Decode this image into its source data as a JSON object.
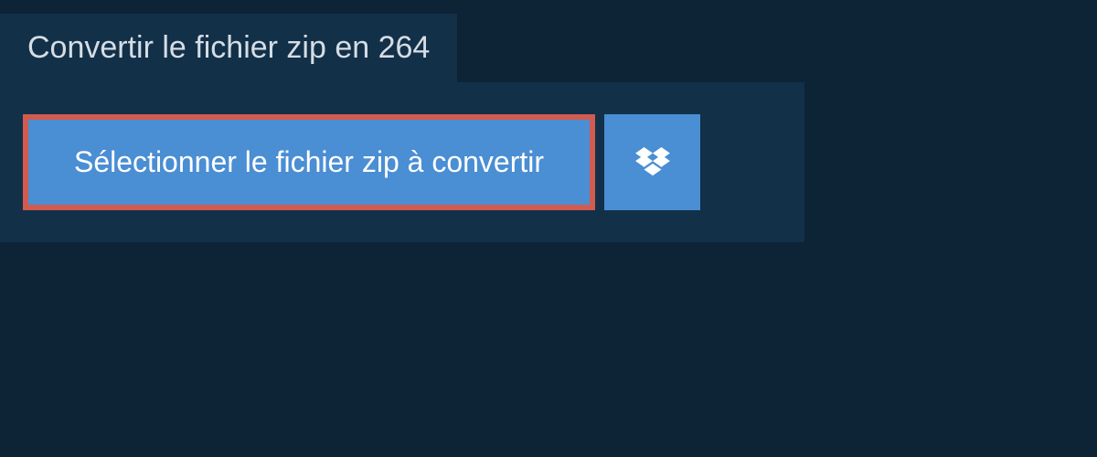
{
  "tab": {
    "title": "Convertir le fichier zip en 264"
  },
  "buttons": {
    "select_file": "Sélectionner le fichier zip à convertir"
  },
  "colors": {
    "background": "#0d2336",
    "panel": "#133049",
    "button": "#4a8ed4",
    "highlight_border": "#d25b50"
  }
}
